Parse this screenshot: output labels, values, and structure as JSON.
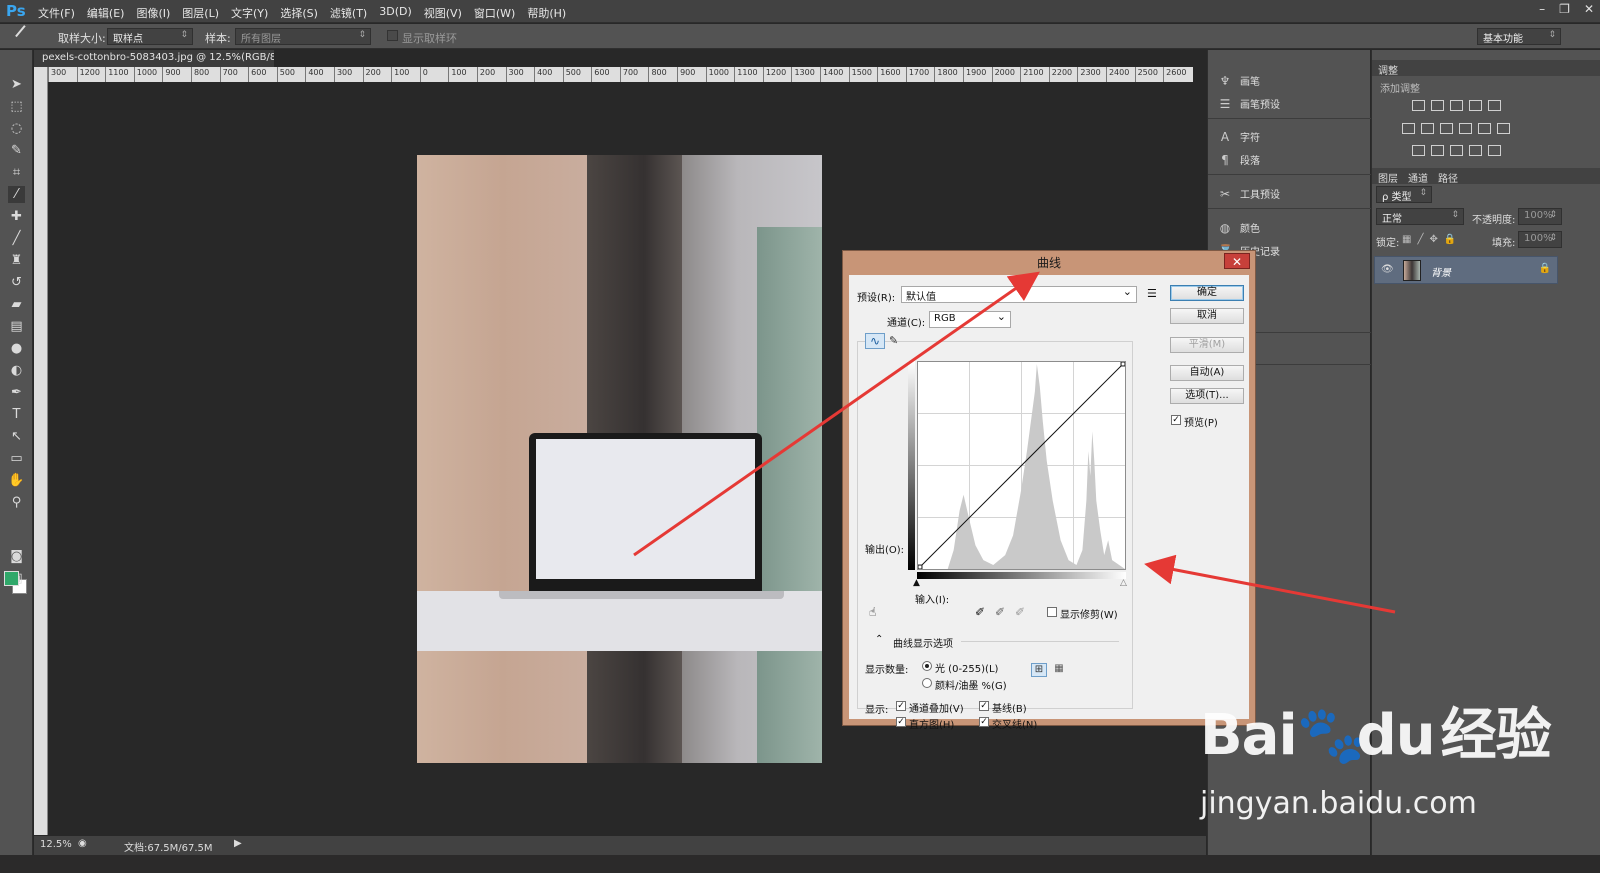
{
  "app": {
    "logo": "Ps"
  },
  "menu": [
    "文件(F)",
    "编辑(E)",
    "图像(I)",
    "图层(L)",
    "文字(Y)",
    "选择(S)",
    "滤镜(T)",
    "3D(D)",
    "视图(V)",
    "窗口(W)",
    "帮助(H)"
  ],
  "window_controls": [
    "–",
    "❐",
    "✕"
  ],
  "options": {
    "sample_size_label": "取样大小:",
    "sample_size_value": "取样点",
    "sample_label": "样本:",
    "sample_value": "所有图层",
    "show_ring_label": "显示取样环",
    "workspace": "基本功能"
  },
  "document": {
    "tab": "pexels-cottonbro-5083403.jpg @ 12.5%(RGB/8)",
    "tab_close": "×",
    "zoom": "12.5%",
    "doc_size": "文档:67.5M/67.5M"
  },
  "ruler_ticks": [
    "300",
    "1200",
    "1100",
    "1000",
    "900",
    "800",
    "700",
    "600",
    "500",
    "400",
    "300",
    "200",
    "100",
    "0",
    "100",
    "200",
    "300",
    "400",
    "500",
    "600",
    "700",
    "800",
    "900",
    "1000",
    "1100",
    "1200",
    "1300",
    "1400",
    "1500",
    "1600",
    "1700",
    "1800",
    "1900",
    "2000",
    "2100",
    "2200",
    "2300",
    "2400",
    "2500",
    "2600"
  ],
  "mid_panels": [
    {
      "label": "画笔",
      "icon": "brush-icon"
    },
    {
      "label": "画笔预设",
      "icon": "brush-preset-icon"
    },
    {
      "label": "字符",
      "icon": "character-icon"
    },
    {
      "label": "段落",
      "icon": "paragraph-icon"
    },
    {
      "label": "工具预设",
      "icon": "tool-preset-icon"
    },
    {
      "label": "颜色",
      "icon": "color-icon"
    },
    {
      "label": "历史记录",
      "icon": "history-icon"
    }
  ],
  "adjustments": {
    "tab": "调整",
    "add_label": "添加调整"
  },
  "layers": {
    "tabs": [
      "图层",
      "通道",
      "路径"
    ],
    "filter_kind": "ρ 类型",
    "blend_mode": "正常",
    "opacity_label": "不透明度:",
    "opacity_value": "100%",
    "lock_label": "锁定:",
    "fill_label": "填充:",
    "fill_value": "100%",
    "layer_name": "背景"
  },
  "curves_dialog": {
    "title": "曲线",
    "close": "✕",
    "preset_label": "预设(R):",
    "preset_value": "默认值",
    "channel_label": "通道(C):",
    "channel_value": "RGB",
    "output_label": "输出(O):",
    "input_label": "输入(I):",
    "show_clipping": "显示修剪(W)",
    "display_options": "曲线显示选项",
    "show_amount_label": "显示数量:",
    "light_option": "光 (0-255)(L)",
    "pigment_option": "颜料/油墨 %(G)",
    "show_label": "显示:",
    "channel_overlay": "通道叠加(V)",
    "baseline": "基线(B)",
    "histogram": "直方图(H)",
    "intersection": "交叉线(N)",
    "buttons": {
      "ok": "确定",
      "cancel": "取消",
      "smooth": "平滑(M)",
      "auto": "自动(A)",
      "options": "选项(T)..."
    },
    "preview": "预览(P)"
  },
  "watermark": {
    "brand_a": "Bai",
    "brand_b": "du",
    "brand_cn": "经验",
    "url": "jingyan.baidu.com"
  },
  "colors": {
    "foreground": "#30a86a",
    "background": "#ffffff",
    "annotation_arrow": "#e53935",
    "dialog_frame": "#c89577"
  }
}
